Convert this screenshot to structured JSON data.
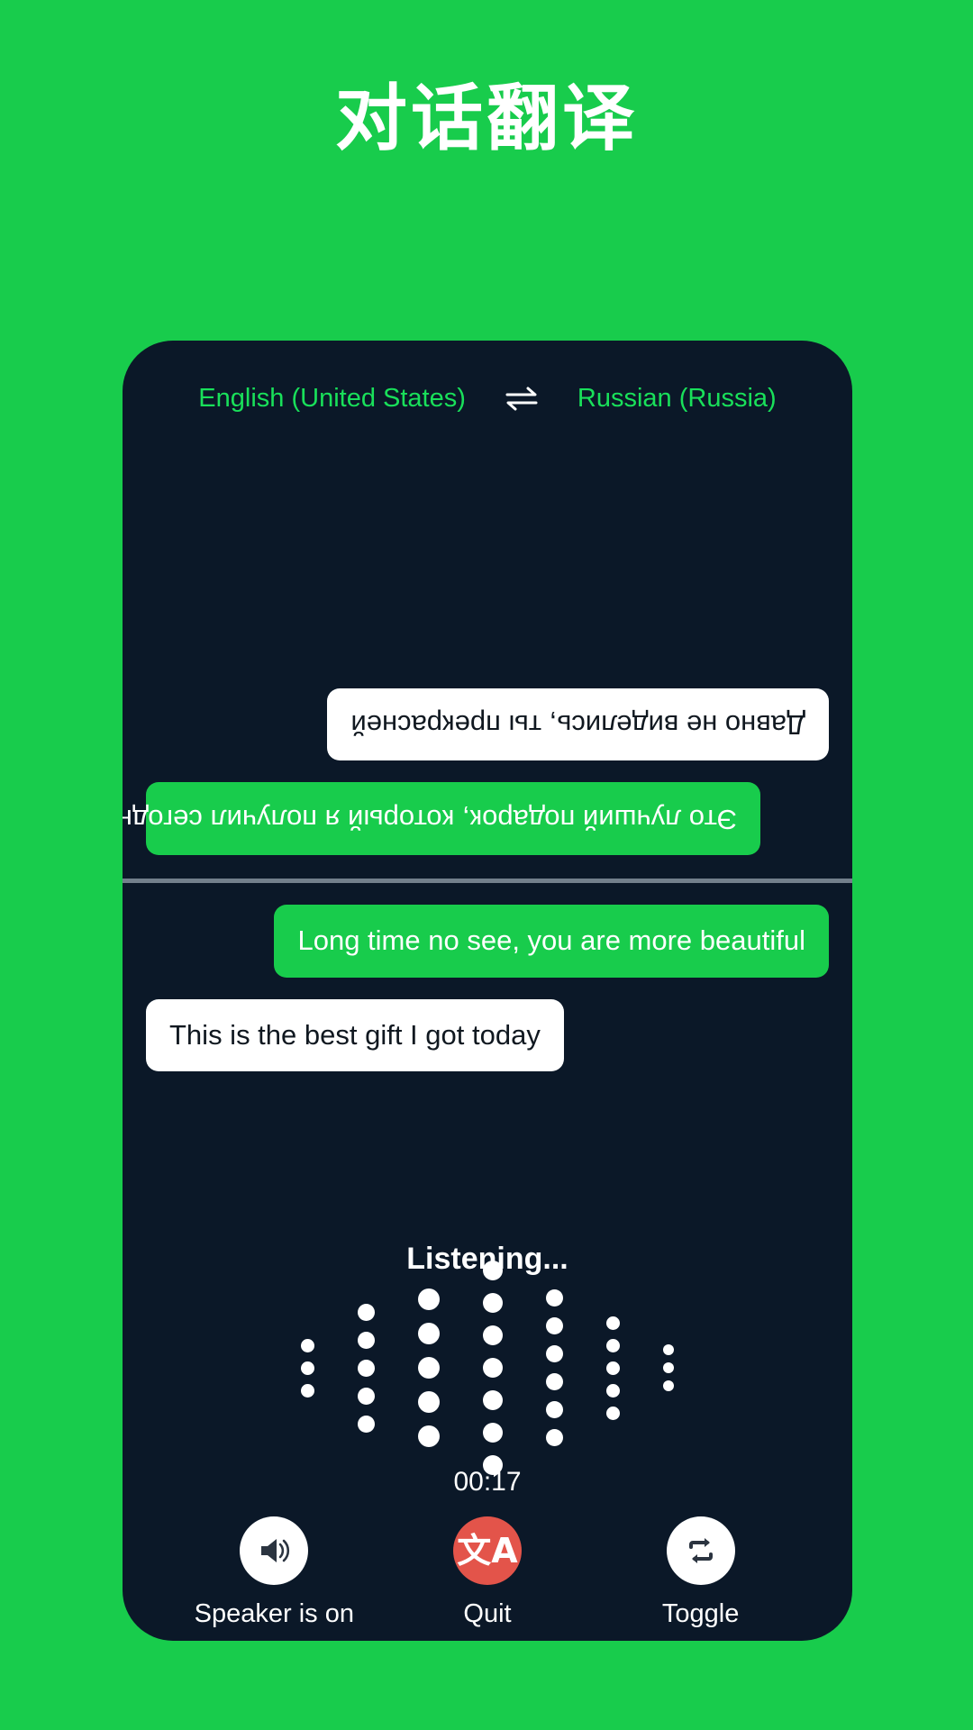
{
  "page": {
    "title": "对话翻译",
    "background_color": "#18cc4c",
    "card_color": "#0b1828",
    "accent_green": "#19e05a",
    "quit_red": "#e3544a"
  },
  "language_bar": {
    "source": "English (United States)",
    "target": "Russian (Russia)",
    "swap_icon": "swap-horizontal-icon"
  },
  "conversation": {
    "translated_pane": {
      "rotated": true,
      "messages": [
        {
          "text": "Это лучший подарок, который я получил сегодня",
          "style": "green",
          "align": "left"
        },
        {
          "text": "Давно не виделись, ты прекрасней",
          "style": "white",
          "align": "right"
        }
      ]
    },
    "source_pane": {
      "rotated": false,
      "messages": [
        {
          "text": "Long time no see, you are more beautiful",
          "style": "green",
          "align": "right"
        },
        {
          "text": "This is the best gift I got today",
          "style": "white",
          "align": "left"
        }
      ]
    }
  },
  "status": {
    "listening_label": "Listening...",
    "timer": "00:17"
  },
  "waveform": {
    "columns": [
      {
        "dots": 3,
        "size": 15
      },
      {
        "dots": 5,
        "size": 19
      },
      {
        "dots": 5,
        "size": 24
      },
      {
        "dots": 7,
        "size": 22
      },
      {
        "dots": 6,
        "size": 19
      },
      {
        "dots": 5,
        "size": 15
      },
      {
        "dots": 3,
        "size": 12
      }
    ]
  },
  "controls": [
    {
      "label": "Speaker is on",
      "icon": "speaker-on-icon",
      "style": "white"
    },
    {
      "label": "Quit",
      "icon": "translate-icon",
      "style": "red"
    },
    {
      "label": "Toggle",
      "icon": "swap-repeat-icon",
      "style": "white"
    }
  ]
}
